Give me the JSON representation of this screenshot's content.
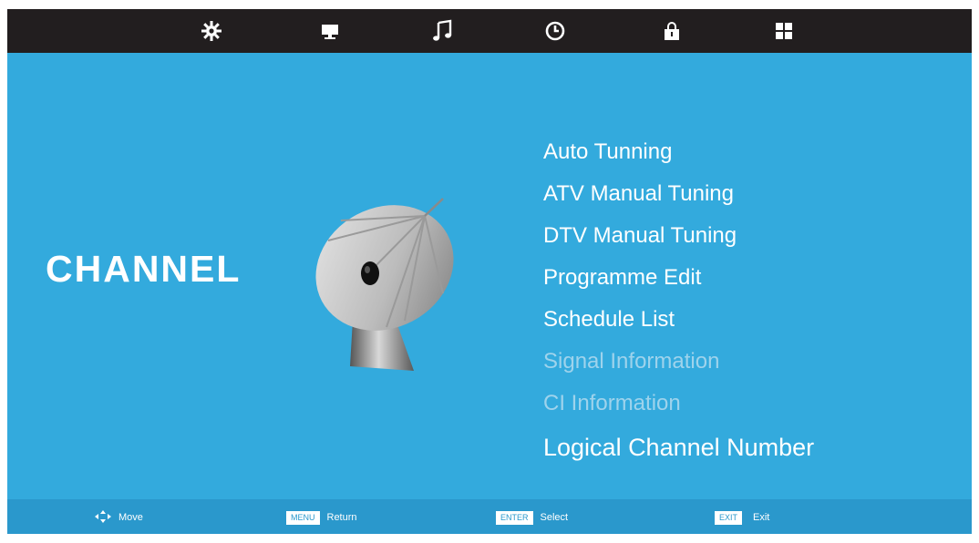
{
  "topbar": {
    "icons": [
      "gear-icon",
      "monitor-icon",
      "music-note-icon",
      "clock-icon",
      "lock-icon",
      "grid-icon"
    ]
  },
  "page": {
    "title": "CHANNEL"
  },
  "menu": {
    "items": [
      {
        "label": "Auto Tunning",
        "enabled": true
      },
      {
        "label": "ATV Manual Tuning",
        "enabled": true
      },
      {
        "label": "DTV Manual Tuning",
        "enabled": true
      },
      {
        "label": "Programme Edit",
        "enabled": true
      },
      {
        "label": "Schedule List",
        "enabled": true
      },
      {
        "label": "Signal Information",
        "enabled": false
      },
      {
        "label": "CI Information",
        "enabled": false
      },
      {
        "label": "Logical Channel Number",
        "enabled": true
      }
    ]
  },
  "footer": {
    "move_label": "Move",
    "menu_key": "MENU",
    "return_label": "Return",
    "enter_key": "ENTER",
    "select_label": "Select",
    "exit_key": "EXIT",
    "exit_label": "Exit"
  },
  "colors": {
    "background": "#33aadd",
    "topbar": "#221e1f",
    "bottombar": "#2a98cc",
    "text": "#ffffff",
    "disabled_text": "#9ed3ec"
  }
}
